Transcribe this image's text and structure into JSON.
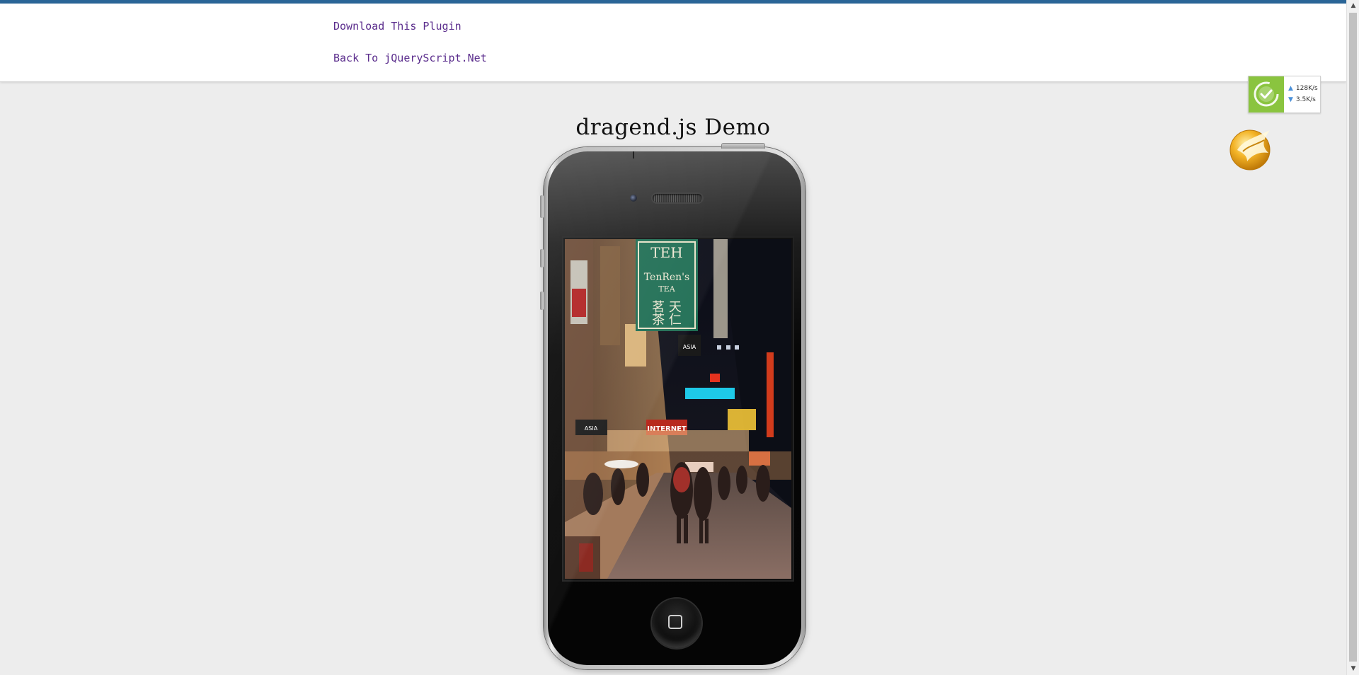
{
  "header": {
    "links": [
      {
        "label": "Download This Plugin"
      },
      {
        "label": "Back To jQueryScript.Net"
      }
    ]
  },
  "main": {
    "title": "dragend.js Demo"
  },
  "network_widget": {
    "upload_rate": "128K/s",
    "download_rate": "3.5K/s",
    "upload_arrow": "▲",
    "download_arrow": "▼",
    "accent_color": "#8ac43f"
  },
  "phone": {
    "home_icon": "home-square-icon"
  },
  "colors": {
    "top_bar": "#2a6597",
    "link": "#5a2c8c",
    "background": "#ededed"
  }
}
